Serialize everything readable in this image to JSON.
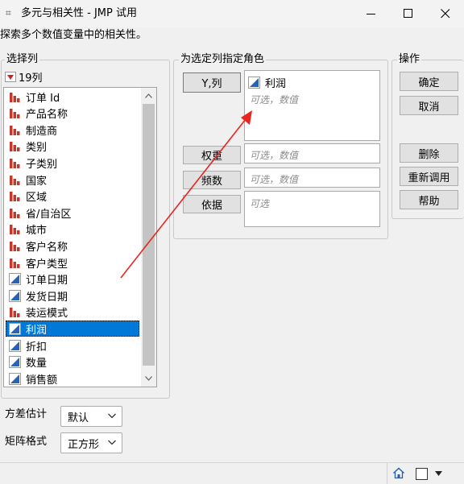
{
  "window": {
    "title": "多元与相关性 - JMP 试用",
    "app_icon_glyph": "⌗"
  },
  "description": "探索多个数值变量中的相关性。",
  "select_columns": {
    "legend": "选择列",
    "count_label": "19列",
    "items": [
      {
        "label": "订单 Id",
        "icon": "nominal-bar-icon"
      },
      {
        "label": "产品名称",
        "icon": "nominal-bar-icon"
      },
      {
        "label": "制造商",
        "icon": "nominal-bar-icon"
      },
      {
        "label": "类别",
        "icon": "nominal-bar-icon"
      },
      {
        "label": "子类别",
        "icon": "nominal-bar-icon"
      },
      {
        "label": "国家",
        "icon": "nominal-bar-icon"
      },
      {
        "label": "区域",
        "icon": "nominal-bar-icon"
      },
      {
        "label": "省/自治区",
        "icon": "nominal-bar-icon"
      },
      {
        "label": "城市",
        "icon": "nominal-bar-icon"
      },
      {
        "label": "客户名称",
        "icon": "nominal-bar-icon"
      },
      {
        "label": "客户类型",
        "icon": "nominal-bar-icon"
      },
      {
        "label": "订单日期",
        "icon": "continuous-triangle-icon"
      },
      {
        "label": "发货日期",
        "icon": "continuous-triangle-icon"
      },
      {
        "label": "装运模式",
        "icon": "nominal-bar-icon"
      },
      {
        "label": "利润",
        "icon": "continuous-triangle-icon",
        "selected": true
      },
      {
        "label": "折扣",
        "icon": "continuous-triangle-icon"
      },
      {
        "label": "数量",
        "icon": "continuous-triangle-icon"
      },
      {
        "label": "销售额",
        "icon": "continuous-triangle-icon"
      }
    ]
  },
  "roles": {
    "legend": "为选定列指定角色",
    "y_button": "Y,列",
    "y_value": "利润",
    "y_placeholder": "可选，数值",
    "weight_button": "权重",
    "weight_placeholder": "可选，数值",
    "freq_button": "频数",
    "freq_placeholder": "可选，数值",
    "by_button": "依据",
    "by_placeholder": "可选"
  },
  "actions": {
    "legend": "操作",
    "ok": "确定",
    "cancel": "取消",
    "remove": "删除",
    "recall": "重新调用",
    "help": "帮助"
  },
  "options": {
    "variance_label": "方差估计",
    "variance_value": "默认",
    "matrix_label": "矩阵格式",
    "matrix_value": "正方形"
  },
  "colors": {
    "nominal_red": "#c0392b",
    "continuous_blue": "#2a62b8",
    "selection_blue": "#0078d7",
    "annotation_red": "#e8251f"
  }
}
